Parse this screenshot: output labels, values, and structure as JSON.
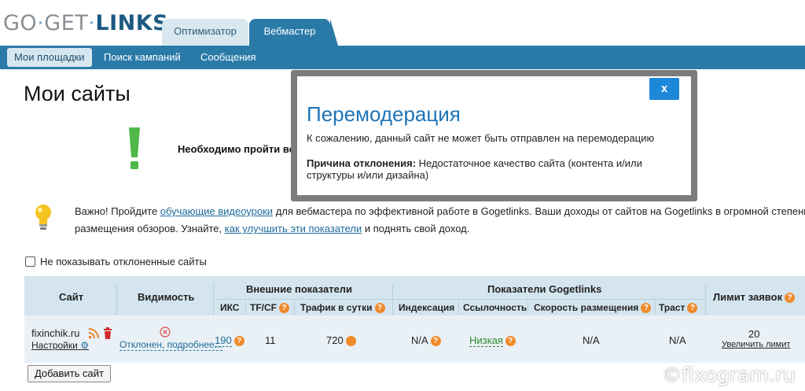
{
  "logo": {
    "part1": "GO",
    "part2": "GET",
    "part3": "LINKS"
  },
  "top_tabs": [
    {
      "label": "Оптимизатор"
    },
    {
      "label": "Вебмастер"
    }
  ],
  "subnav": [
    {
      "label": "Мои площадки"
    },
    {
      "label": "Поиск кампаний"
    },
    {
      "label": "Сообщения"
    }
  ],
  "page_title": "Мои сайты",
  "warning_text": "Необходимо пройти ве",
  "info": {
    "line1_a": "Важно! Пройдите ",
    "line1_link": "обучающие видеоуроки",
    "line1_b": " для вебмастера по эффективной работе в Gogetlinks. Ваши доходы от сайтов на Gogetlinks в огромной степени",
    "line2_a": "размещения обзоров. Узнайте, ",
    "line2_link": "как улучшить эти показатели",
    "line2_b": " и поднять свой доход."
  },
  "hide_rejected_label": "Не показывать отклоненные сайты",
  "table": {
    "headers": {
      "site": "Сайт",
      "visibility": "Видимость",
      "external": "Внешние показатели",
      "gogetlinks": "Показатели Gogetlinks",
      "limit": "Лимит заявок",
      "iks": "ИКС",
      "tfcf": "TF/CF",
      "traffic": "Трафик в сутки",
      "indexing": "Индексация",
      "linkability": "Ссылочность",
      "speed": "Скорость размещения",
      "trust": "Траст"
    },
    "row": {
      "site": "fixinchik.ru",
      "settings": "Настройки",
      "visibility": "Отклонен, подробнее...",
      "iks": "190",
      "tfcf": "11",
      "traffic": "720",
      "indexing": "N/A",
      "linkability": "Низкая",
      "speed": "N/A",
      "trust": "N/A",
      "limit": "20",
      "increase_limit": "Увеличить лимит"
    }
  },
  "add_site_label": "Добавить сайт",
  "watermark": "©fixogram.ru",
  "modal": {
    "close": "x",
    "title": "Перемодерация",
    "message": "К сожалению, данный сайт не может быть отправлен на перемодерацию",
    "reason_label": "Причина отклонения:",
    "reason_text": " Недостаточное качество сайта (контента и/или структуры и/или дизайна)"
  },
  "colors": {
    "accent": "#2a7aa8",
    "link": "#1e6a9a",
    "question_icon": "#f08a2a",
    "modal_title": "#1e73b6",
    "warning_green": "#4fb848"
  }
}
